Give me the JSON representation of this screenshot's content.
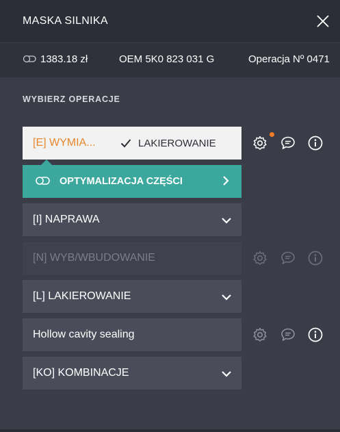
{
  "header": {
    "title": "MASKA SILNIKA"
  },
  "info": {
    "price": "1383.18 zł",
    "oem": "OEM 5K0 823 031 G",
    "operation": "Operacja Nº 0471"
  },
  "section_title": "WYBIERZ OPERACJE",
  "operations": [
    {
      "label": "[E] WYMIA...",
      "tag": "LAKIEROWANIE",
      "state": "active"
    },
    {
      "label": "[I] NAPRAWA",
      "state": "collapsed"
    },
    {
      "label": "[N] WYB/WBUDOWANIE",
      "state": "disabled"
    },
    {
      "label": "[L] LAKIEROWANIE",
      "state": "collapsed"
    },
    {
      "label": "Hollow cavity sealing",
      "state": "plain"
    },
    {
      "label": "[KO] KOMBINACJE",
      "state": "collapsed"
    }
  ],
  "optimization": {
    "label": "OPTYMALIZACJA CZĘŚCI"
  },
  "colors": {
    "accent_orange": "#e8872e",
    "teal": "#3ca89d",
    "notification_dot": "#f07c2a"
  }
}
